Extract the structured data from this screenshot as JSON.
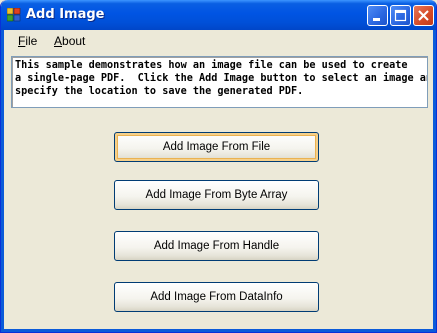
{
  "window": {
    "title": "Add Image"
  },
  "menu": {
    "file": {
      "mnemonic": "F",
      "rest": "ile"
    },
    "about": {
      "mnemonic": "A",
      "rest": "bout"
    }
  },
  "description": {
    "lines": [
      "This sample demonstrates how an image file can be used to create",
      "a single-page PDF.  Click the Add Image button to select an image and",
      "specify the location to save the generated PDF."
    ]
  },
  "buttons": {
    "from_file": "Add Image From File",
    "from_byte_array": "Add Image From Byte Array",
    "from_handle": "Add Image From Handle",
    "from_datainfo": "Add Image From DataInfo"
  },
  "colors": {
    "titlebar": "#0054e3",
    "window_bg": "#ece9d8",
    "close_button": "#d54a26"
  },
  "icons": {
    "app": "app-icon",
    "minimize": "minimize-icon",
    "maximize": "maximize-icon",
    "close": "close-icon"
  }
}
